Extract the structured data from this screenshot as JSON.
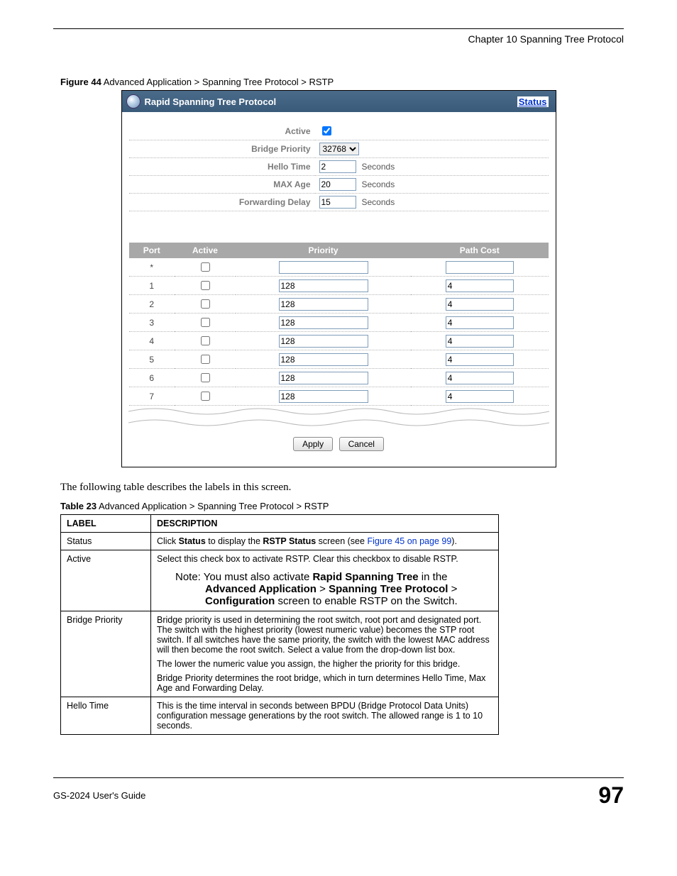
{
  "chapter_line": "Chapter 10 Spanning Tree Protocol",
  "figure": {
    "label": "Figure 44",
    "text": "   Advanced Application > Spanning Tree Protocol > RSTP"
  },
  "screenshot": {
    "title": "Rapid Spanning Tree Protocol",
    "status_link": "Status",
    "rows": {
      "active": {
        "label": "Active",
        "checked": true
      },
      "bridge_priority": {
        "label": "Bridge Priority",
        "value": "32768"
      },
      "hello_time": {
        "label": "Hello Time",
        "value": "2",
        "unit": "Seconds"
      },
      "max_age": {
        "label": "MAX Age",
        "value": "20",
        "unit": "Seconds"
      },
      "fwd_delay": {
        "label": "Forwarding Delay",
        "value": "15",
        "unit": "Seconds"
      }
    },
    "port_headers": [
      "Port",
      "Active",
      "Priority",
      "Path Cost"
    ],
    "ports": [
      {
        "port": "*",
        "active": false,
        "priority": "",
        "path_cost": ""
      },
      {
        "port": "1",
        "active": false,
        "priority": "128",
        "path_cost": "4"
      },
      {
        "port": "2",
        "active": false,
        "priority": "128",
        "path_cost": "4"
      },
      {
        "port": "3",
        "active": false,
        "priority": "128",
        "path_cost": "4"
      },
      {
        "port": "4",
        "active": false,
        "priority": "128",
        "path_cost": "4"
      },
      {
        "port": "5",
        "active": false,
        "priority": "128",
        "path_cost": "4"
      },
      {
        "port": "6",
        "active": false,
        "priority": "128",
        "path_cost": "4"
      },
      {
        "port": "7",
        "active": false,
        "priority": "128",
        "path_cost": "4"
      }
    ],
    "buttons": {
      "apply": "Apply",
      "cancel": "Cancel"
    }
  },
  "intro": "The following table describes the labels in this screen.",
  "table_caption": {
    "label": "Table 23",
    "text": "   Advanced Application > Spanning Tree Protocol > RSTP"
  },
  "desc_table": {
    "headers": [
      "LABEL",
      "DESCRIPTION"
    ],
    "status": {
      "label": "Status",
      "pre": "Click ",
      "b1": "Status",
      "mid": " to display the ",
      "b2": "RSTP Status",
      "post": " screen (see ",
      "link": "Figure 45 on page 99",
      "end": ")."
    },
    "active": {
      "label": "Active",
      "line1": "Select this check box to activate RSTP. Clear this checkbox to disable RSTP.",
      "note_pre": "Note: You must also activate ",
      "note_b1": "Rapid Spanning Tree",
      "note_mid1": " in the ",
      "note_b2": "Advanced Application",
      "note_gt1": " > ",
      "note_b3": "Spanning Tree Protocol",
      "note_gt2": " > ",
      "note_b4": "Configuration",
      "note_end": " screen to enable RSTP on the Switch."
    },
    "bridge_priority": {
      "label": "Bridge Priority",
      "p1": "Bridge priority is used in determining the root switch, root port and designated port. The switch with the highest priority (lowest numeric value) becomes the STP root switch. If all switches have the same priority, the switch with the lowest MAC address will then become the root switch. Select a value from the drop-down list box.",
      "p2": "The lower the numeric value you assign, the higher the priority for this bridge.",
      "p3": "Bridge Priority determines the root bridge, which in turn determines Hello Time, Max Age and Forwarding Delay."
    },
    "hello_time": {
      "label": "Hello Time",
      "p1": "This is the time interval in seconds between BPDU (Bridge Protocol Data Units) configuration message generations by the root switch. The allowed range is 1 to 10 seconds."
    }
  },
  "footer": {
    "guide": "GS-2024 User's Guide",
    "page": "97"
  }
}
